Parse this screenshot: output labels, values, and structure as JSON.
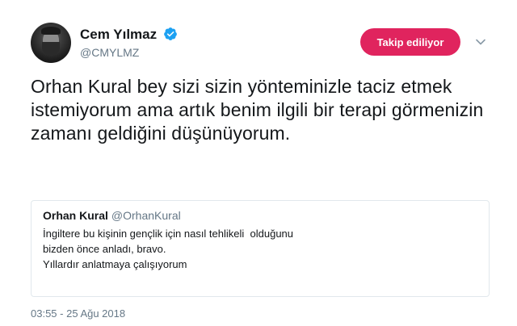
{
  "author": {
    "name": "Cem Yılmaz",
    "handle": "@CMYLMZ",
    "verified": true
  },
  "follow_button": {
    "label": "Takip ediliyor",
    "color": "#e0245e"
  },
  "tweet": {
    "text": "Orhan Kural bey sizi sizin yönteminizle taciz etmek istemiyorum ama artık benim ilgili bir terapi görmenizin zamanı geldiğini düşünüyorum."
  },
  "quoted_tweet": {
    "name": "Orhan Kural",
    "handle": "@OrhanKural",
    "lines": [
      "İngiltere bu kişinin gençlik için nasıl tehlikeli  olduğunu",
      "bizden önce anladı, bravo.",
      "Yıllardır anlatmaya çalışıyorum"
    ]
  },
  "timestamp": "03:55 - 25 Ağu 2018",
  "icons": {
    "verified": "verified-badge-icon",
    "menu": "chevron-down-icon"
  },
  "colors": {
    "accent": "#1da1f2",
    "secondary_text": "#657786",
    "border": "#e1e8ed"
  }
}
